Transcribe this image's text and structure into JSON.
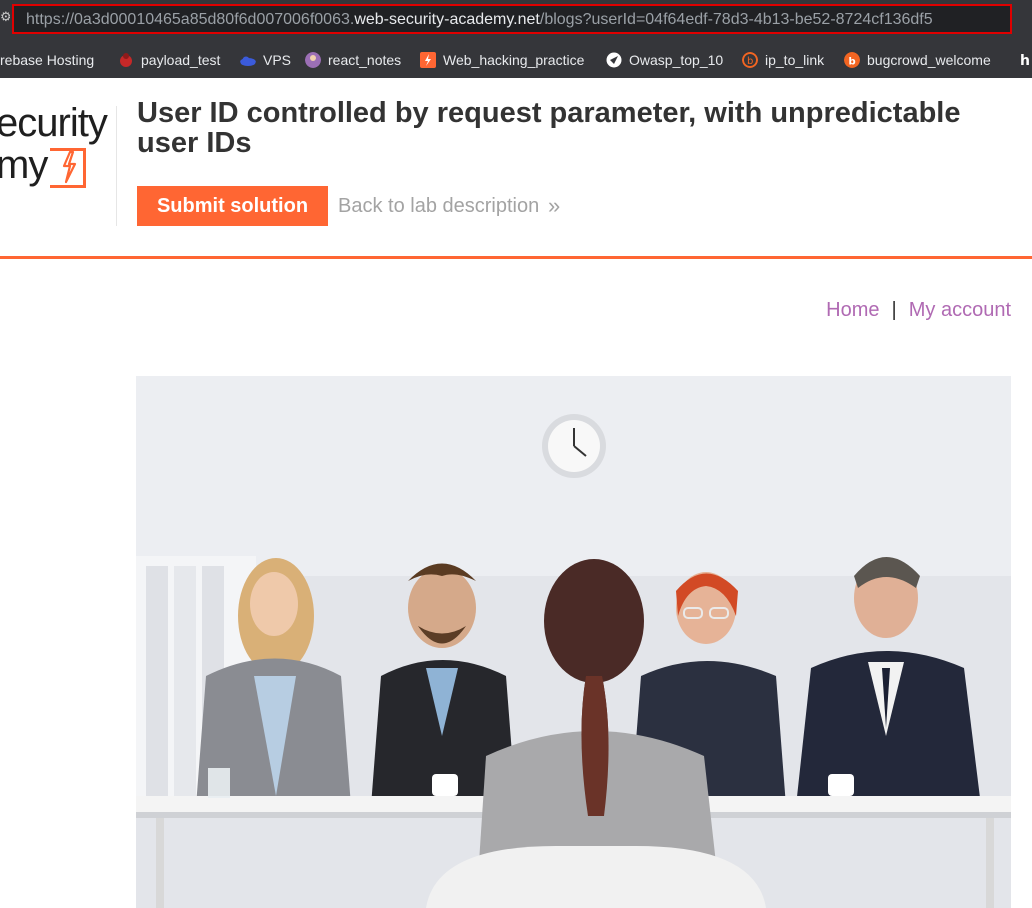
{
  "browser": {
    "url_scheme_sub": "https://0a3d00010465a85d80f6d007006f0063.",
    "url_host": "web-security-academy.net",
    "url_path": "/blogs?userId=04f64edf-78d3-4b13-be52-8724cf136df5",
    "bookmarks": [
      {
        "label": "rebase Hosting",
        "icon": "firebase-icon",
        "color": "#f5a623"
      },
      {
        "label": "payload_test",
        "icon": "bug-icon",
        "color": "#d32f2f"
      },
      {
        "label": "VPS",
        "icon": "cloud-icon",
        "color": "#3b5bdb"
      },
      {
        "label": "react_notes",
        "icon": "avatar-icon",
        "color": "#9c6fb6"
      },
      {
        "label": "Web_hacking_practice",
        "icon": "bolt-icon",
        "color": "#ff6633"
      },
      {
        "label": "Owasp_top_10",
        "icon": "compass-icon",
        "color": "#ffffff"
      },
      {
        "label": "ip_to_link",
        "icon": "b-icon",
        "color": "#f26522"
      },
      {
        "label": "bugcrowd_welcome",
        "icon": "bugcrowd-icon",
        "color": "#f26522"
      }
    ]
  },
  "header": {
    "logo_line1": "ecurity",
    "logo_line2": "my",
    "lab_title": "User ID controlled by request parameter, with unpredictable user IDs",
    "submit_label": "Submit solution",
    "back_label": "Back to lab description",
    "back_chevron": "»",
    "accent_color": "#ff6633"
  },
  "nav": {
    "home": "Home",
    "separator": "|",
    "account": "My account"
  }
}
